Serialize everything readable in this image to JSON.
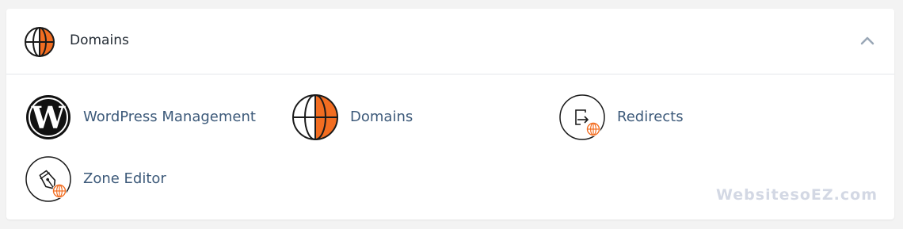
{
  "section": {
    "title": "Domains",
    "header_icon": "globe-icon",
    "collapse_icon": "chevron-up-icon"
  },
  "tools": [
    {
      "label": "WordPress Management",
      "icon": "wordpress-icon"
    },
    {
      "label": "Domains",
      "icon": "globe-icon"
    },
    {
      "label": "Redirects",
      "icon": "redirect-icon"
    },
    {
      "label": "Zone Editor",
      "icon": "zone-editor-icon"
    }
  ],
  "watermark": "WebsitesoEZ.com",
  "colors": {
    "accent_orange": "#f26d21",
    "link_text": "#3d5a7a",
    "title_text": "#222a33",
    "divider": "#e3e6ea",
    "page_background": "#f3f3f3"
  }
}
